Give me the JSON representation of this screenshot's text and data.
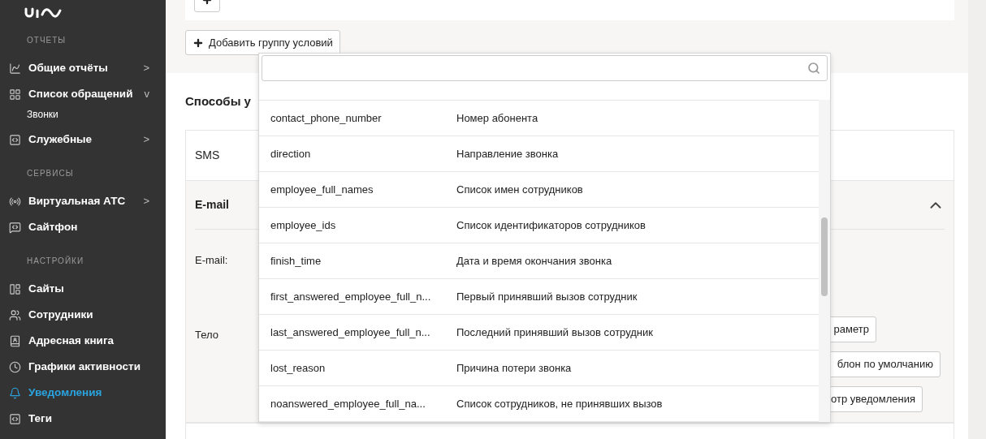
{
  "sidebar": {
    "sections": [
      {
        "title": "ОТЧЕТЫ",
        "items": [
          {
            "label": "Общие отчёты",
            "kind": "chart",
            "arrow": ">",
            "selected": false
          },
          {
            "label": "Список обращений",
            "kind": "grid",
            "arrow": "v",
            "selected": false,
            "children": [
              {
                "label": "Звонки",
                "selected": false
              }
            ]
          },
          {
            "label": "Служебные",
            "kind": "code",
            "arrow": ">",
            "selected": false
          }
        ]
      },
      {
        "title": "СЕРВИСЫ",
        "items": [
          {
            "label": "Виртуальная АТС",
            "kind": "signal",
            "arrow": ">",
            "selected": false
          },
          {
            "label": "Сайтфон",
            "kind": "chat",
            "selected": false
          }
        ]
      },
      {
        "title": "НАСТРОЙКИ",
        "items": [
          {
            "label": "Сайты",
            "kind": "table",
            "selected": false
          },
          {
            "label": "Сотрудники",
            "kind": "users",
            "selected": false
          },
          {
            "label": "Адресная книга",
            "kind": "book",
            "selected": false
          },
          {
            "label": "Графики активности",
            "kind": "clock",
            "selected": false
          },
          {
            "label": "Уведомления",
            "kind": "bell",
            "selected": true
          },
          {
            "label": "Теги",
            "kind": "code",
            "selected": false
          }
        ]
      }
    ]
  },
  "main": {
    "add_group_button": "Добавить группу условий",
    "section_title": "Способы у",
    "channels": [
      {
        "label": "SMS",
        "expanded": false
      },
      {
        "label": "E-mail",
        "expanded": true
      }
    ],
    "email_form": {
      "fields": [
        "E-mail:",
        "Тело"
      ],
      "buttons": [
        "раметр",
        "блон по умолчанию",
        "отр уведомления"
      ]
    }
  },
  "dropdown": {
    "rows": [
      {
        "name": "contact_phone_number",
        "description": "Номер абонента"
      },
      {
        "name": "direction",
        "description": "Направление звонка"
      },
      {
        "name": "employee_full_names",
        "description": "Список имен сотрудников"
      },
      {
        "name": "employee_ids",
        "description": "Список идентификаторов сотрудников"
      },
      {
        "name": "finish_time",
        "description": "Дата и время окончания звонка"
      },
      {
        "name": "first_answered_employee_full_n...",
        "description": "Первый принявший вызов сотрудник"
      },
      {
        "name": "last_answered_employee_full_n...",
        "description": "Последний принявший вызов сотрудник"
      },
      {
        "name": "lost_reason",
        "description": "Причина потери звонка"
      },
      {
        "name": "noanswered_employee_full_na...",
        "description": "Список сотрудников, не принявших вызов"
      }
    ]
  }
}
